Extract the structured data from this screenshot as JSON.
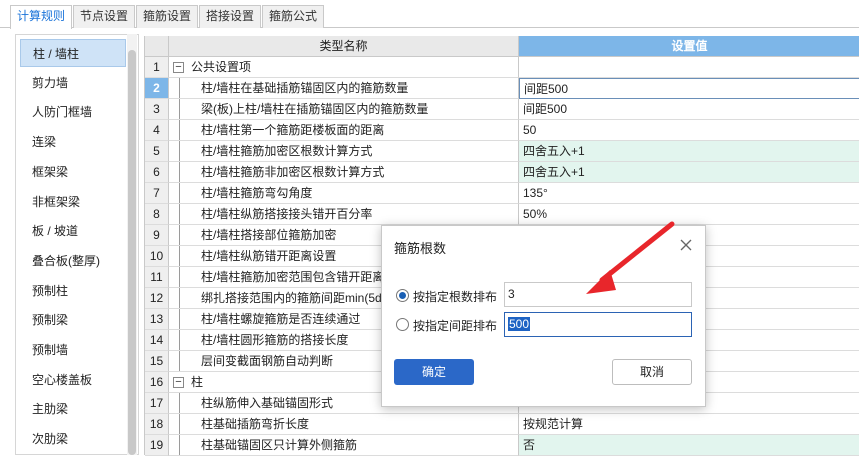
{
  "tabs": [
    "计算规则",
    "节点设置",
    "箍筋设置",
    "搭接设置",
    "箍筋公式"
  ],
  "active_tab": 0,
  "sidebar": {
    "items": [
      "柱 / 墙柱",
      "剪力墙",
      "人防门框墙",
      "连梁",
      "框架梁",
      "非框架梁",
      "板 / 坡道",
      "叠合板(整厚)",
      "预制柱",
      "预制梁",
      "预制墙",
      "空心楼盖板",
      "主肋梁",
      "次肋梁"
    ],
    "active": 0
  },
  "grid": {
    "header_name": "类型名称",
    "header_value": "设置值",
    "rows": [
      {
        "num": "1",
        "name": "公共设置项",
        "value": "",
        "group": true
      },
      {
        "num": "2",
        "name": "柱/墙柱在基础插筋锚固区内的箍筋数量",
        "value": "间距500",
        "style": "editing",
        "selected": true
      },
      {
        "num": "3",
        "name": "梁(板)上柱/墙柱在插筋锚固区内的箍筋数量",
        "value": "间距500"
      },
      {
        "num": "4",
        "name": "柱/墙柱第一个箍筋距楼板面的距离",
        "value": "50"
      },
      {
        "num": "5",
        "name": "柱/墙柱箍筋加密区根数计算方式",
        "value": "四舍五入+1",
        "style": "green"
      },
      {
        "num": "6",
        "name": "柱/墙柱箍筋非加密区根数计算方式",
        "value": "四舍五入+1",
        "style": "green"
      },
      {
        "num": "7",
        "name": "柱/墙柱箍筋弯勾角度",
        "value": "135°"
      },
      {
        "num": "8",
        "name": "柱/墙柱纵筋搭接接头错开百分率",
        "value": "50%"
      },
      {
        "num": "9",
        "name": "柱/墙柱搭接部位箍筋加密",
        "value": ""
      },
      {
        "num": "10",
        "name": "柱/墙柱纵筋错开距离设置",
        "value": ""
      },
      {
        "num": "11",
        "name": "柱/墙柱箍筋加密范围包含错开距离",
        "value": ""
      },
      {
        "num": "12",
        "name": "绑扎搭接范围内的箍筋间距min(5d",
        "value": ""
      },
      {
        "num": "13",
        "name": "柱/墙柱螺旋箍筋是否连续通过",
        "value": ""
      },
      {
        "num": "14",
        "name": "柱/墙柱圆形箍筋的搭接长度",
        "value": ""
      },
      {
        "num": "15",
        "name": "层间变截面钢筋自动判断",
        "value": ""
      },
      {
        "num": "16",
        "name": "柱",
        "value": "",
        "group": true
      },
      {
        "num": "17",
        "name": "柱纵筋伸入基础锚固形式",
        "value": ""
      },
      {
        "num": "18",
        "name": "柱基础插筋弯折长度",
        "value": "按规范计算"
      },
      {
        "num": "19",
        "name": "柱基础锚固区只计算外侧箍筋",
        "value": "否",
        "style": "green"
      }
    ]
  },
  "dialog": {
    "title": "箍筋根数",
    "option_count_label": "按指定根数排布",
    "option_count_value": "3",
    "option_spacing_label": "按指定间距排布",
    "option_spacing_value": "500",
    "checked": "count",
    "ok_label": "确定",
    "cancel_label": "取消"
  },
  "colors": {
    "accent": "#2b68c8",
    "header_blue": "#7db6e8",
    "green_cell": "#e2f5ee",
    "arrow": "#e8262b"
  }
}
